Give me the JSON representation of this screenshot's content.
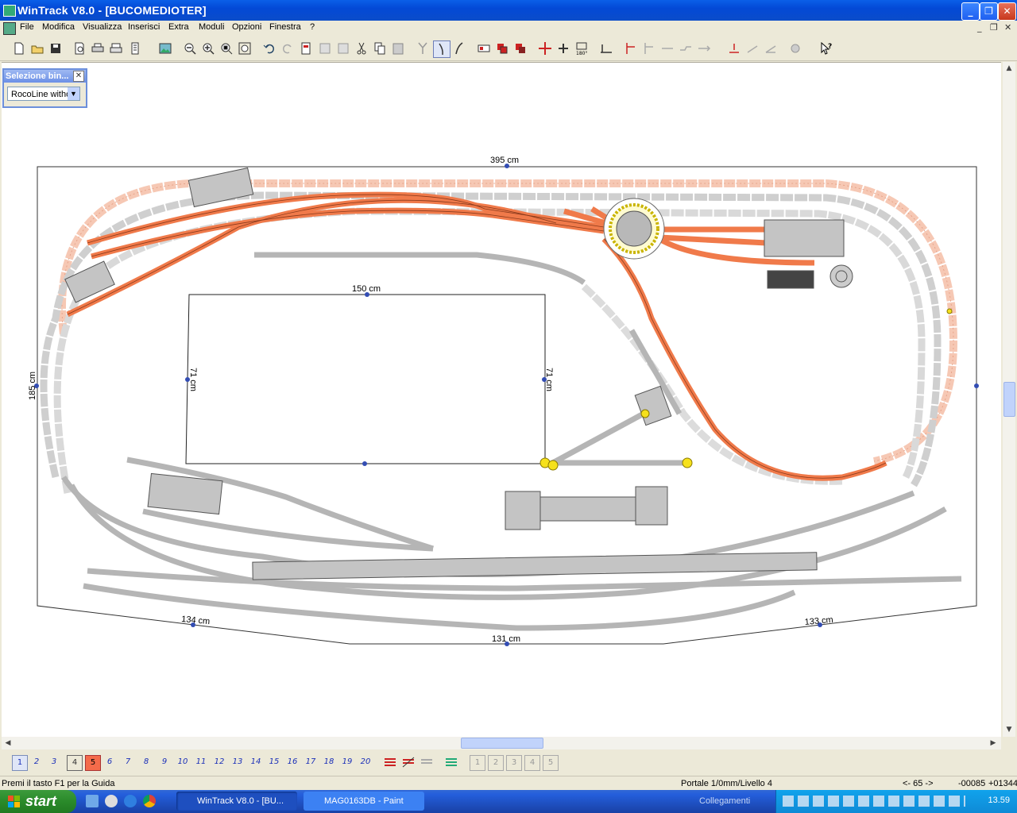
{
  "window": {
    "title": "WinTrack  V8.0 - [BUCOMEDIOTER]"
  },
  "menu": {
    "items": [
      "File",
      "Modifica",
      "Visualizza",
      "Inserisci",
      "Extra",
      "Moduli",
      "Opzioni",
      "Finestra",
      "?"
    ]
  },
  "panel": {
    "title": "Selezione bin...",
    "selected": "RocoLine witho"
  },
  "dimensions": {
    "top": "395 cm",
    "left": "185 cm",
    "inner_top": "150 cm",
    "inner_left": "71 cm",
    "inner_right": "71 cm",
    "bottom_left": "134 cm",
    "bottom_center": "131 cm",
    "bottom_right": "133 cm"
  },
  "layers": {
    "buttons": [
      "1",
      "2",
      "3",
      "4",
      "5",
      "6",
      "7",
      "8",
      "9",
      "10",
      "11",
      "12",
      "13",
      "14",
      "15",
      "16",
      "17",
      "18",
      "19",
      "20"
    ],
    "modules": [
      "1",
      "2",
      "3",
      "4",
      "5"
    ]
  },
  "status": {
    "help": "Premi il tasto F1 per la Guida",
    "portale": "Portale 1/0mm/Livello 4",
    "counter": "<- 65 ->",
    "coords_x": "-00085",
    "coords_y": "+01344"
  },
  "taskbar": {
    "start": "start",
    "buttons": [
      "WinTrack  V8.0 - [BU...",
      "MAG0163DB - Paint"
    ],
    "links": "Collegamenti",
    "clock": "13.59"
  },
  "colors": {
    "orange_track": "#f07a4a",
    "grey_track": "#b8b8b8",
    "title_blue": "#0349d6"
  }
}
